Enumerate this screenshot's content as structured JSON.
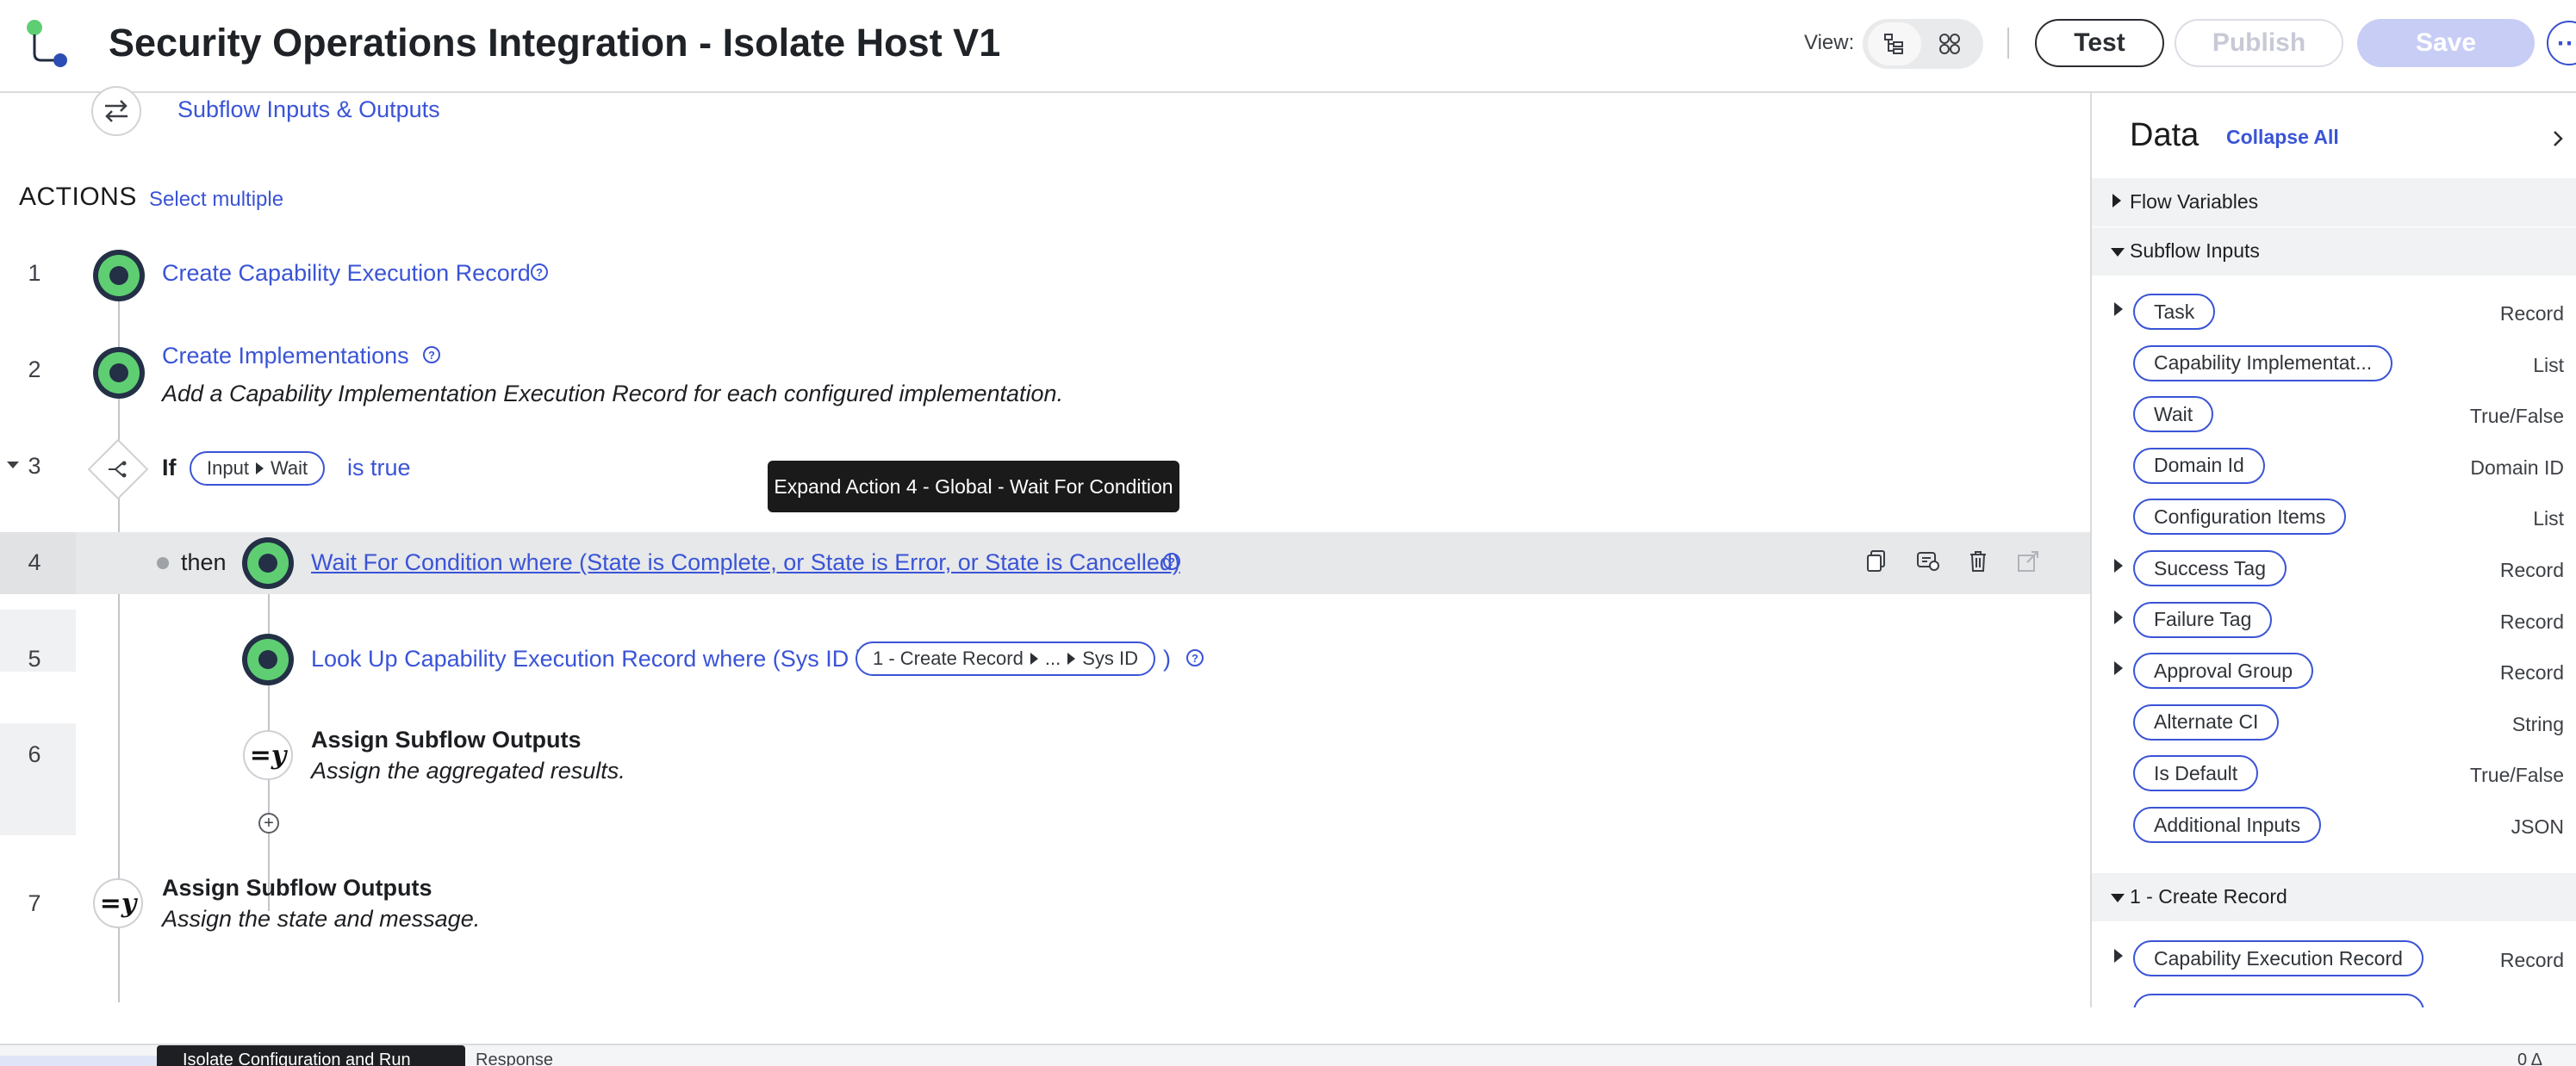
{
  "header": {
    "title": "Security Operations Integration - Isolate Host V1",
    "view_label": "View:",
    "test_label": "Test",
    "publish_label": "Publish",
    "save_label": "Save",
    "more_label": "⋯"
  },
  "canvas": {
    "io_link": "Subflow Inputs & Outputs",
    "actions_title": "ACTIONS",
    "select_multiple": "Select multiple",
    "rows": [
      {
        "num": "1",
        "label": "Create Capability Execution Record"
      },
      {
        "num": "2",
        "label": "Create Implementations",
        "desc": "Add a Capability Implementation Execution Record for each configured implementation."
      },
      {
        "num": "3",
        "if_label": "If",
        "pill_a": "Input",
        "pill_b": "Wait",
        "cond": "is true"
      },
      {
        "num": "4",
        "then_label": "then",
        "label": "Wait For Condition where (State is Complete, or State is Error, or State is Cancelled)"
      },
      {
        "num": "5",
        "label": "Look Up Capability Execution Record where (Sys ID is",
        "pill_a": "1 - Create Record",
        "pill_b": "...",
        "pill_c": "Sys ID",
        "close": ")"
      },
      {
        "num": "6",
        "label": "Assign Subflow Outputs",
        "desc": "Assign the aggregated results.",
        "icon_text": "=y"
      },
      {
        "num": "7",
        "label": "Assign Subflow Outputs",
        "desc": "Assign the state and message.",
        "icon_text": "=y"
      }
    ],
    "tooltip": "Expand Action 4 - Global - Wait For Condition"
  },
  "data_panel": {
    "title": "Data",
    "collapse_all": "Collapse All",
    "sections": [
      {
        "label": "Flow Variables"
      },
      {
        "label": "Subflow Inputs"
      },
      {
        "label": "1 - Create Record"
      }
    ],
    "subflow_inputs": [
      {
        "name": "Task",
        "type": "Record",
        "expandable": true
      },
      {
        "name": "Capability Implementat...",
        "type": "List",
        "expandable": false
      },
      {
        "name": "Wait",
        "type": "True/False",
        "expandable": false
      },
      {
        "name": "Domain Id",
        "type": "Domain ID",
        "expandable": false
      },
      {
        "name": "Configuration Items",
        "type": "List",
        "expandable": false
      },
      {
        "name": "Success Tag",
        "type": "Record",
        "expandable": true
      },
      {
        "name": "Failure Tag",
        "type": "Record",
        "expandable": true
      },
      {
        "name": "Approval Group",
        "type": "Record",
        "expandable": true
      },
      {
        "name": "Alternate CI",
        "type": "String",
        "expandable": false
      },
      {
        "name": "Is Default",
        "type": "True/False",
        "expandable": false
      },
      {
        "name": "Additional Inputs",
        "type": "JSON",
        "expandable": false
      }
    ],
    "create_record_items": [
      {
        "name": "Capability Execution Record",
        "type": "Record",
        "expandable": true
      }
    ]
  },
  "bottom_bar": {
    "tab_dark": "Isolate Configuration and Run",
    "response": "Response",
    "right": "0 Δ"
  },
  "colors": {
    "link": "#3a54d6",
    "node_green": "#5fce73",
    "node_dark": "#233045",
    "save_disabled": "#c7cdf5"
  }
}
